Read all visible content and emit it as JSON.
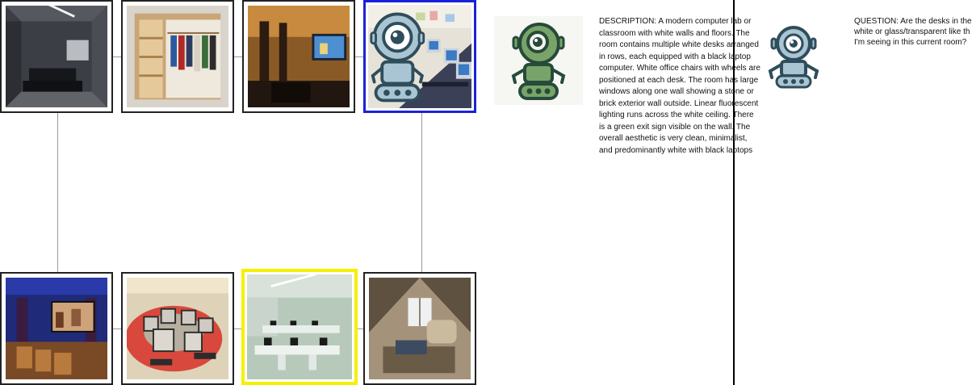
{
  "grid": {
    "tiles": [
      {
        "name": "home-theater-dark-thumbnail",
        "highlight": "none"
      },
      {
        "name": "closet-shelves-thumbnail",
        "highlight": "none"
      },
      {
        "name": "tv-lounge-thumbnail",
        "highlight": "none"
      },
      {
        "name": "computer-lab-robot-thumbnail",
        "highlight": "blue"
      },
      {
        "name": "blue-theater-thumbnail",
        "highlight": "none"
      },
      {
        "name": "round-computer-desk-thumbnail",
        "highlight": "none"
      },
      {
        "name": "white-computer-lab-thumbnail",
        "highlight": "yellow"
      },
      {
        "name": "attic-living-room-thumbnail",
        "highlight": "none"
      }
    ],
    "colors": {
      "blue_highlight": "#1a22d8",
      "yellow_highlight": "#f5f000"
    }
  },
  "assistant": {
    "robot_icon": "robot-icon",
    "description": "DESCRIPTION: A modern computer lab or classroom with white walls and floors. The room contains multiple white desks arranged in rows, each equipped with a black laptop computer. White office chairs with wheels are positioned at each desk. The room has large windows along one wall showing a stone or brick exterior wall outside. Linear fluorescent lighting runs across the white ceiling. There is a green exit sign visible on the wall. The overall aesthetic is very clean, minimalist, and predominantly white with black laptops"
  },
  "user": {
    "robot_icon": "robot-icon",
    "question": "QUESTION: Are the desks in the\nwhite or glass/transparent like th\nI'm seeing in this current room?"
  }
}
